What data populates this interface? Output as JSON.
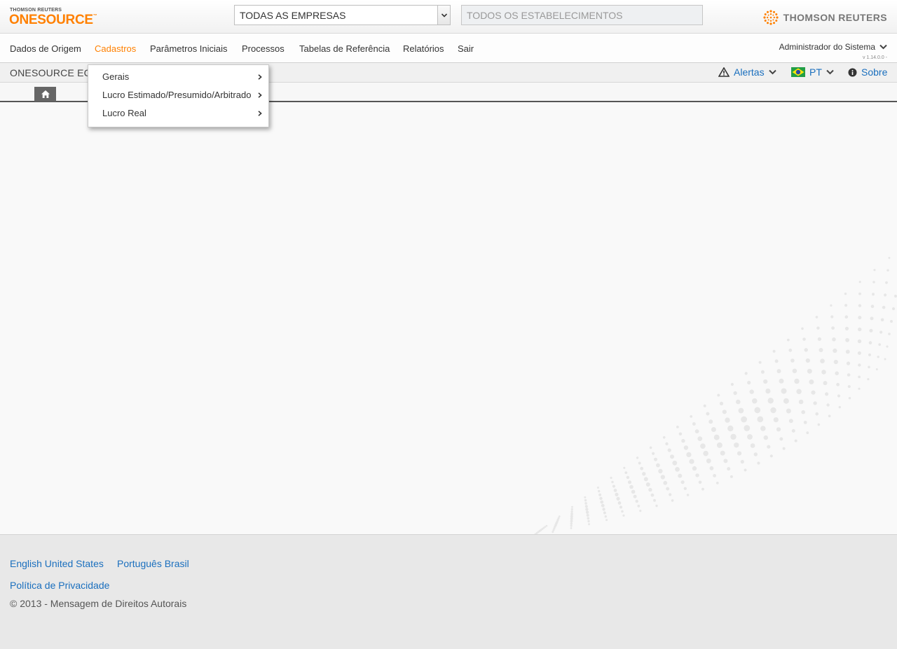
{
  "header": {
    "brand_small": "THOMSON REUTERS",
    "brand_name": "ONESOURCE",
    "brand_tm": "™",
    "company_select": {
      "value": "TODAS AS EMPRESAS"
    },
    "establishment_field": {
      "placeholder": "TODOS OS ESTABELECIMENTOS"
    },
    "vendor_logo_text": "THOMSON REUTERS",
    "vendor_logo_icon": "thomson-reuters-sphere-icon"
  },
  "nav": {
    "items": [
      {
        "label": "Dados de Origem",
        "active": false
      },
      {
        "label": "Cadastros",
        "active": true
      },
      {
        "label": "Parâmetros Iniciais",
        "active": false
      },
      {
        "label": "Processos",
        "active": false
      },
      {
        "label": "Tabelas de Referência",
        "active": false
      },
      {
        "label": "Relatórios",
        "active": false
      },
      {
        "label": "Sair",
        "active": false
      }
    ],
    "user": "Administrador do Sistema",
    "version": "v 1.14.0.0 -"
  },
  "subbar": {
    "product_name": "ONESOURCE EC",
    "alerts_label": "Alertas",
    "language_label": "PT",
    "about_label": "Sobre"
  },
  "dropdown": {
    "items": [
      {
        "label": "Gerais"
      },
      {
        "label": "Lucro Estimado/Presumido/Arbitrado"
      },
      {
        "label": "Lucro Real"
      }
    ]
  },
  "footer": {
    "lang_en": "English United States",
    "lang_pt": "Português Brasil",
    "privacy": "Política de Privacidade",
    "copyright": "© 2013 - Mensagem de Direitos Autorais"
  },
  "colors": {
    "accent": "#ff8000",
    "link": "#1a6fbe"
  }
}
